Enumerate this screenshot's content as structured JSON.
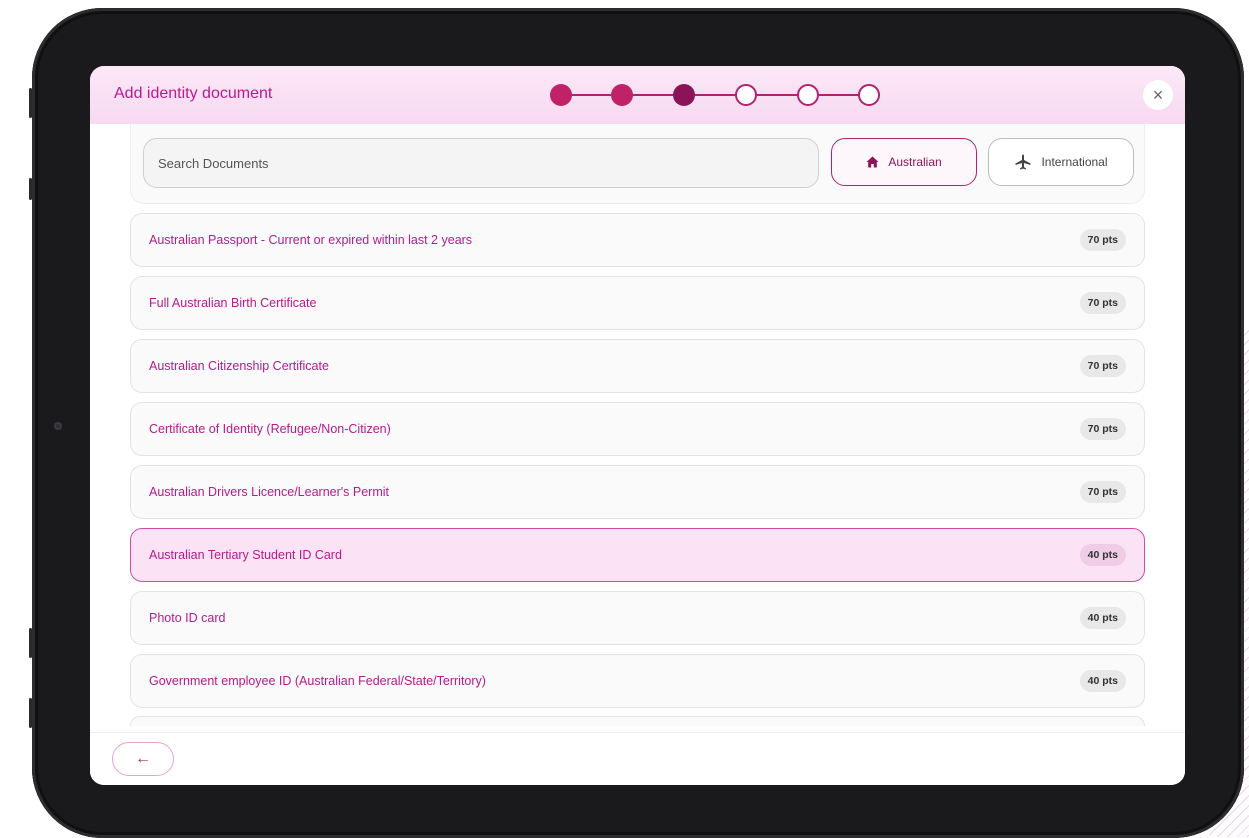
{
  "dialog": {
    "title": "Add identity document",
    "close_label": "×"
  },
  "stepper": {
    "total_steps": 6,
    "current_step": 3,
    "steps": [
      "done",
      "done",
      "current",
      "todo",
      "todo",
      "todo"
    ]
  },
  "search": {
    "placeholder": "Search Documents",
    "value": ""
  },
  "filters": {
    "australian": {
      "label": "Australian",
      "icon": "home-icon",
      "active": true
    },
    "international": {
      "label": "International",
      "icon": "airplane-icon",
      "active": false
    }
  },
  "documents": [
    {
      "label": "Australian Passport - Current or expired within last 2 years",
      "points": "70 pts"
    },
    {
      "label": "Full Australian Birth Certificate",
      "points": "70 pts"
    },
    {
      "label": "Australian Citizenship Certificate",
      "points": "70 pts"
    },
    {
      "label": "Certificate of Identity (Refugee/Non-Citizen)",
      "points": "70 pts"
    },
    {
      "label": "Australian Drivers Licence/Learner's Permit",
      "points": "70 pts"
    },
    {
      "label": "Australian Tertiary Student ID Card",
      "points": "40 pts",
      "selected": true
    },
    {
      "label": "Photo ID card",
      "points": "40 pts"
    },
    {
      "label": "Government employee ID (Australian Federal/State/Territory)",
      "points": "40 pts"
    }
  ],
  "footer": {
    "back_label": "←",
    "back_icon": "arrow-left-icon"
  },
  "colors": {
    "accent": "#b0246f",
    "accent_dark": "#8a1457",
    "text_pink": "#b51b8e",
    "header_bg": "#f8dcf2",
    "selected_bg": "#fbe3f5"
  }
}
